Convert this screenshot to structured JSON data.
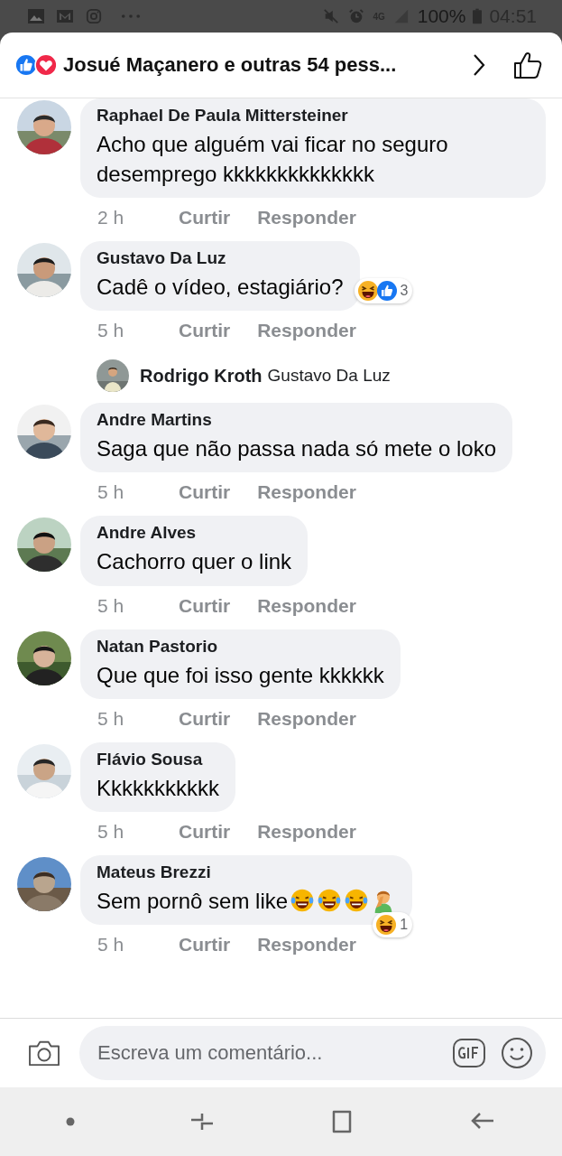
{
  "status_bar": {
    "time": "04:51",
    "battery": "100%",
    "network": "4G"
  },
  "header": {
    "title": "Josué Maçanero e outras 54 pess...",
    "reactions": [
      {
        "kind": "like"
      },
      {
        "kind": "love"
      }
    ]
  },
  "comments": [
    {
      "author": "Raphael De Paula Mittersteiner",
      "text": "Acho que alguém vai ficar no seguro desemprego kkkkkkkkkkkkkk",
      "time": "2 h",
      "like_label": "Curtir",
      "reply_label": "Responder"
    },
    {
      "author": "Gustavo Da Luz",
      "text": "Cadê o vídeo, estagiário?",
      "time": "5 h",
      "like_label": "Curtir",
      "reply_label": "Responder",
      "reactions": {
        "kinds": [
          {
            "kind": "haha"
          },
          {
            "kind": "like"
          }
        ],
        "count": "3"
      },
      "replies": [
        {
          "author": "Rodrigo Kroth",
          "text": "Gustavo Da Luz"
        }
      ]
    },
    {
      "author": "Andre Martins",
      "text": "Saga que não passa nada só mete o loko",
      "time": "5 h",
      "like_label": "Curtir",
      "reply_label": "Responder"
    },
    {
      "author": "Andre Alves",
      "text": "Cachorro quer o link",
      "time": "5 h",
      "like_label": "Curtir",
      "reply_label": "Responder"
    },
    {
      "author": "Natan Pastorio",
      "text": "Que que foi isso gente kkkkkk",
      "time": "5 h",
      "like_label": "Curtir",
      "reply_label": "Responder"
    },
    {
      "author": "Flávio Sousa",
      "text": "Kkkkkkkkkkk",
      "time": "5 h",
      "like_label": "Curtir",
      "reply_label": "Responder"
    },
    {
      "author": "Mateus Brezzi",
      "text": "Sem pornô sem like",
      "emojis": [
        {
          "kind": "tears_of_joy"
        },
        {
          "kind": "tears_of_joy"
        },
        {
          "kind": "tears_of_joy"
        },
        {
          "kind": "facepalm"
        }
      ],
      "time": "5 h",
      "like_label": "Curtir",
      "reply_label": "Responder",
      "reactions": {
        "kinds": [
          {
            "kind": "haha"
          }
        ],
        "count": "1"
      }
    }
  ],
  "composer": {
    "placeholder": "Escreva um comentário..."
  }
}
